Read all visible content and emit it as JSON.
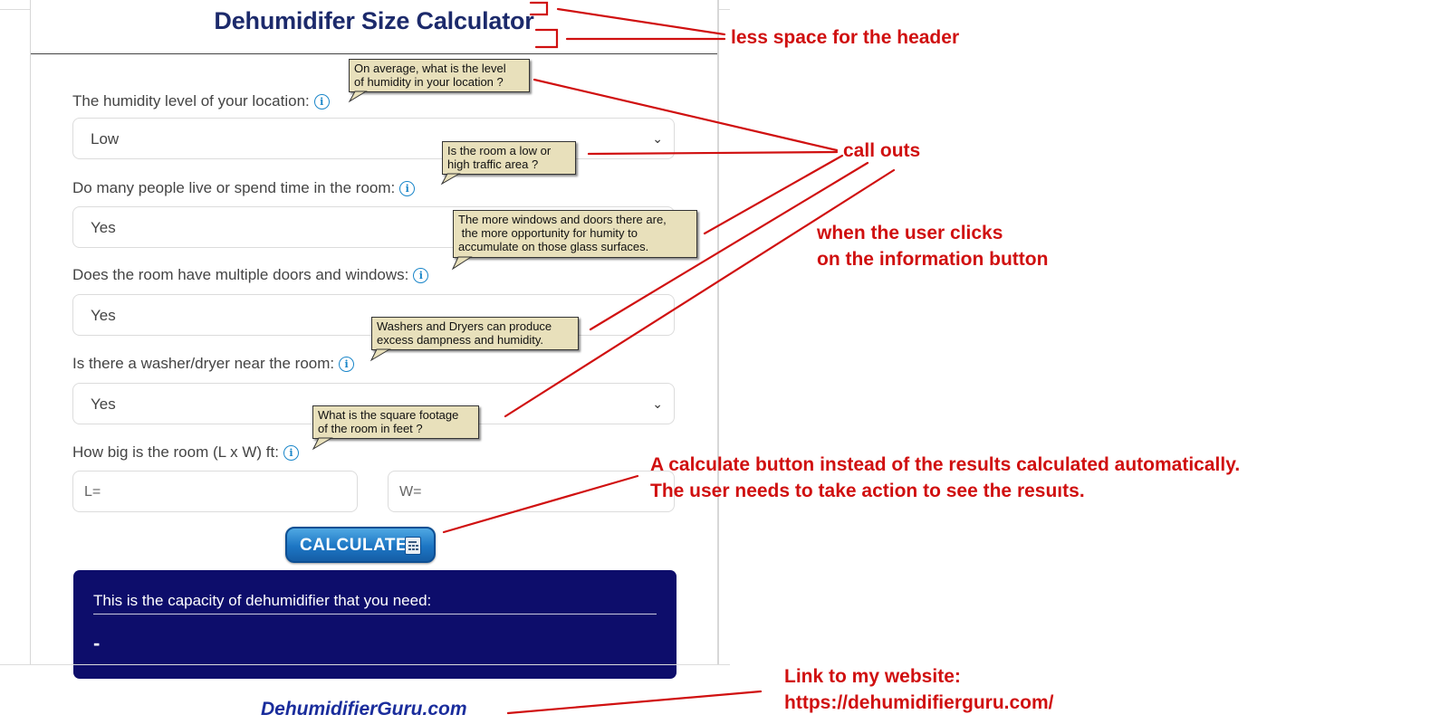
{
  "header": {
    "title": "Dehumidifer Size Calculator"
  },
  "form": {
    "q1": {
      "label": "The humidity level of your location:",
      "value": "Low"
    },
    "q2": {
      "label": "Do many people live or spend time in the room:",
      "value": "Yes"
    },
    "q3": {
      "label": "Does the room have multiple doors and windows:",
      "value": "Yes"
    },
    "q4": {
      "label": "Is there a washer/dryer near the room:",
      "value": "Yes"
    },
    "q5": {
      "label": "How big is the room (L x W) ft:"
    },
    "length_placeholder": "L=",
    "width_placeholder": "W=",
    "info_glyph": "i"
  },
  "calculate": {
    "label": "CALCULATE"
  },
  "result": {
    "title": "This is the capacity of dehumidifier that you need:",
    "value": "-"
  },
  "footer": {
    "site_link": "DehumidifierGuru.com"
  },
  "callouts": {
    "c1": {
      "line1": "On average, what is the level",
      "line2": "of humidity in your location ?"
    },
    "c2": {
      "line1": "Is the room a low or",
      "line2": "high traffic area ?"
    },
    "c3": {
      "line1": "The more windows and doors there are,",
      "line2": " the more opportunity for humity to",
      "line3": "accumulate on those glass surfaces."
    },
    "c4": {
      "line1": "Washers and Dryers can produce",
      "line2": "excess dampness and humidity."
    },
    "c5": {
      "line1": "What is the square footage",
      "line2": "of the room in feet ?"
    }
  },
  "annotations": {
    "header_note": "less space for the header",
    "callouts_note": "call outs",
    "info_note_line1": "when the user clicks",
    "info_note_line2": "on the information button",
    "calc_note_line1": "A calculate button instead of the results calculated automatically.",
    "calc_note_line2": "The user needs to take action to see the resuıts.",
    "link_note_line1": "Link to my website:",
    "link_note_line2": "https://dehumidifierguru.com/"
  },
  "colors": {
    "annotation_red": "#d01010",
    "title_navy": "#1c2a6b",
    "result_bg": "#0d0d6b",
    "info_blue": "#1a86c9",
    "callout_bg": "#e8e0bb"
  }
}
